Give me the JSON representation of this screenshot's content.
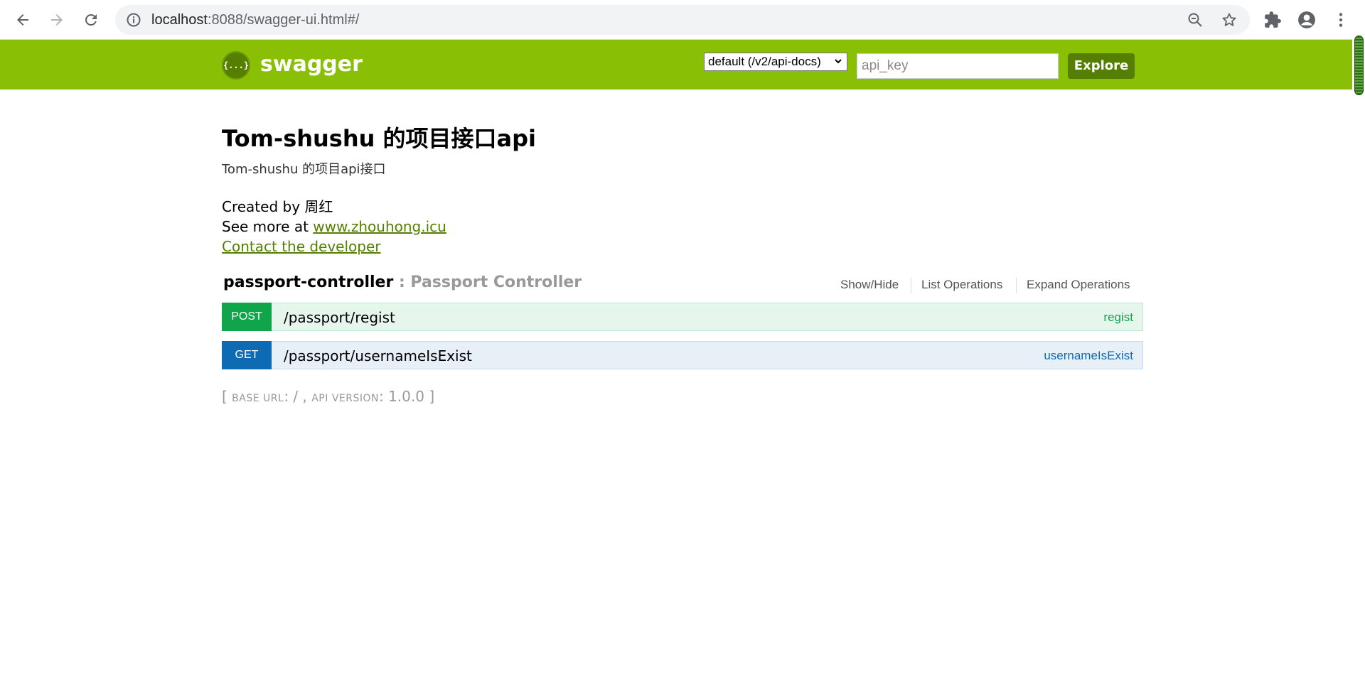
{
  "browser": {
    "url_host": "localhost",
    "url_rest": ":8088/swagger-ui.html#/"
  },
  "header": {
    "logo_glyph": "{...}",
    "title": "swagger",
    "spec_select": "default (/v2/api-docs)",
    "api_key_placeholder": "api_key",
    "explore_label": "Explore",
    "color": "#89bf04"
  },
  "info": {
    "title": "Tom-shushu 的项目接口api",
    "description": "Tom-shushu 的项目api接口",
    "created_by": "Created by 周红",
    "see_more_prefix": "See more at ",
    "see_more_link": "www.zhouhong.icu",
    "contact": "Contact the developer"
  },
  "resource": {
    "name": "passport-controller",
    "separator_desc": " : Passport Controller",
    "ops_links": [
      "Show/Hide",
      "List Operations",
      "Expand Operations"
    ],
    "operations": [
      {
        "method": "POST",
        "path": "/passport/regist",
        "summary": "regist",
        "color": "#10a54a"
      },
      {
        "method": "GET",
        "path": "/passport/usernameIsExist",
        "summary": "usernameIsExist",
        "color": "#0f6ab4"
      }
    ]
  },
  "footer": {
    "open": "[ ",
    "base_url_label": "base url",
    "base_url_value": ": / , ",
    "api_version_label": "api version",
    "api_version_value": ": 1.0.0 ]"
  }
}
